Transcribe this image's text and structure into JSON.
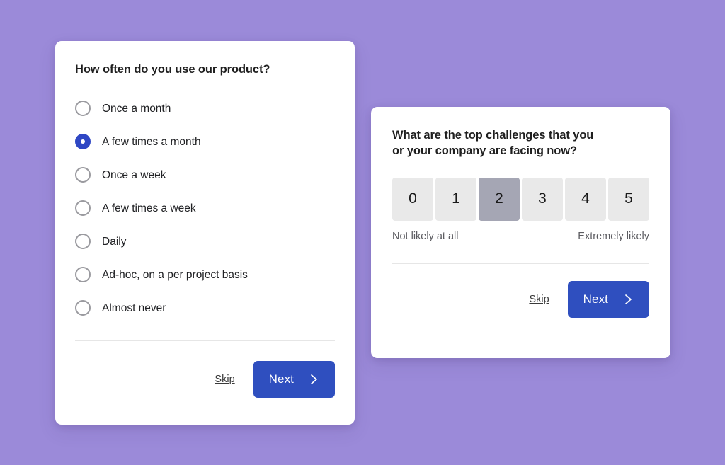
{
  "theme": {
    "background": "#9b8ad9",
    "card_background": "#ffffff",
    "accent_blue": "#2f4fbf",
    "radio_selected": "#2f47c4",
    "scale_default": "#e9e9e9",
    "scale_selected": "#a5a6b4"
  },
  "frequency_card": {
    "title": "How often do you use our product?",
    "options": [
      {
        "label": "Once a month",
        "selected": false
      },
      {
        "label": "A few times a month",
        "selected": true
      },
      {
        "label": "Once a week",
        "selected": false
      },
      {
        "label": "A few times a week",
        "selected": false
      },
      {
        "label": "Daily",
        "selected": false
      },
      {
        "label": "Ad-hoc, on a per project basis",
        "selected": false
      },
      {
        "label": "Almost never",
        "selected": false
      }
    ],
    "footer": {
      "skip_label": "Skip",
      "next_label": "Next",
      "next_icon": "chevron-right-icon"
    }
  },
  "nps_card": {
    "title": "What are the top challenges that you or your company are facing now?",
    "scale": {
      "values": [
        "0",
        "1",
        "2",
        "3",
        "4",
        "5"
      ],
      "selected_value": "2",
      "low_label": "Not likely at all",
      "high_label": "Extremely likely"
    },
    "footer": {
      "skip_label": "Skip",
      "next_label": "Next",
      "next_icon": "chevron-right-icon"
    }
  }
}
